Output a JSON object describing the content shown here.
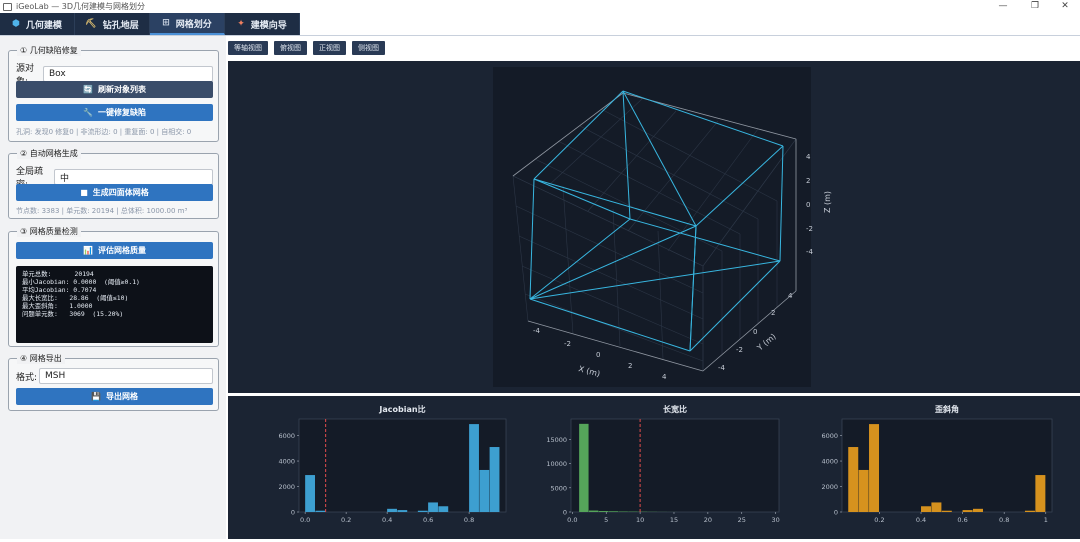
{
  "window": {
    "title": "iGeoLab — 3D几何建模与网格划分",
    "minimize_glyph": "—",
    "maximize_glyph": "❐",
    "close_glyph": "✕"
  },
  "tabs": [
    {
      "label": "几何建模",
      "icon": "cube-icon",
      "glyph": "⬢"
    },
    {
      "label": "钻孔地层",
      "icon": "drill-icon",
      "glyph": "⛏"
    },
    {
      "label": "网格划分",
      "icon": "mesh-icon",
      "glyph": "⊞"
    },
    {
      "label": "建模向导",
      "icon": "wand-icon",
      "glyph": "✦"
    }
  ],
  "repair": {
    "title": "① 几何缺陷修复",
    "source_label": "源对象:",
    "source_value": "Box",
    "refresh_label": "刷新对象列表",
    "refresh_glyph": "🔄",
    "fix_label": "一键修复缺陷",
    "fix_glyph": "🔧",
    "stats": "孔洞: 发现0 修复0 | 非流形边: 0 | 重复面: 0 | 自相交: 0"
  },
  "mesh_gen": {
    "title": "② 自动网格生成",
    "density_label": "全局疏密:",
    "density_value": "中",
    "generate_label": "生成四面体网格",
    "generate_glyph": "■",
    "stats": "节点数: 3383 | 单元数: 20194 | 总体积: 1000.00 m³"
  },
  "quality": {
    "title": "③ 网格质量检测",
    "evaluate_label": "评估网格质量",
    "evaluate_glyph": "📊",
    "report": [
      "单元总数:      20194",
      "最小Jacobian: 0.0000  (阈值≥0.1)",
      "平均Jacobian: 0.7074",
      "最大长宽比:   28.86  (阈值≤10)",
      "最大歪斜角:   1.0000",
      "问题单元数:   3069  (15.20%)"
    ]
  },
  "export": {
    "title": "④ 网格导出",
    "format_label": "格式:",
    "format_value": "MSH",
    "export_label": "导出网格",
    "export_glyph": "💾"
  },
  "view_buttons": [
    "等轴视图",
    "俯视图",
    "正视图",
    "侧视图"
  ],
  "view3d": {
    "xlabel": "X (m)",
    "ylabel": "Y (m)",
    "zlabel": "Z (m)",
    "x_ticks": [
      "-4",
      "-2",
      "0",
      "2",
      "4"
    ],
    "y_ticks": [
      "-4",
      "-2",
      "0",
      "2",
      "4"
    ],
    "z_ticks": [
      "-4",
      "-2",
      "0",
      "2",
      "4"
    ],
    "edge_color": "#38b6e0"
  },
  "chart_data": [
    {
      "type": "bar",
      "title": "Jacobian比",
      "xlabel": "",
      "ylabel": "",
      "bins": [
        0.0,
        0.05,
        0.1,
        0.15,
        0.2,
        0.25,
        0.3,
        0.35,
        0.4,
        0.45,
        0.5,
        0.55,
        0.6,
        0.65,
        0.7,
        0.75,
        0.8,
        0.85,
        0.9,
        0.95
      ],
      "values": [
        2900,
        100,
        0,
        0,
        0,
        0,
        0,
        0,
        250,
        150,
        0,
        100,
        750,
        450,
        0,
        0,
        6900,
        3300,
        5100
      ],
      "xlim": [
        -0.03,
        0.98
      ],
      "ylim": [
        0,
        7300
      ],
      "x_ticks": [
        0.0,
        0.2,
        0.4,
        0.6,
        0.8
      ],
      "y_ticks": [
        0,
        2000,
        4000,
        6000
      ],
      "threshold": 0.1,
      "color": "#3d9fd0",
      "threshold_color": "#e04b4b"
    },
    {
      "type": "bar",
      "title": "长宽比",
      "xlabel": "",
      "ylabel": "",
      "bins": [
        1.0,
        2.45,
        3.9,
        5.35,
        6.8,
        8.25,
        9.7,
        11.15,
        12.6,
        14.05,
        15.5
      ],
      "values": [
        18200,
        300,
        200,
        150,
        100,
        80,
        60,
        40,
        20,
        10
      ],
      "xlim": [
        -0.2,
        30.5
      ],
      "ylim": [
        0,
        19200
      ],
      "x_ticks": [
        0,
        5,
        10,
        15,
        20,
        25,
        30
      ],
      "y_ticks": [
        0,
        5000,
        10000,
        15000
      ],
      "threshold": 10,
      "color": "#55a55a",
      "threshold_color": "#e04b4b"
    },
    {
      "type": "bar",
      "title": "歪斜角",
      "xlabel": "",
      "ylabel": "",
      "bins": [
        0.05,
        0.1,
        0.15,
        0.2,
        0.25,
        0.3,
        0.35,
        0.4,
        0.45,
        0.5,
        0.55,
        0.6,
        0.65,
        0.7,
        0.75,
        0.8,
        0.85,
        0.9,
        0.95,
        1.0
      ],
      "values": [
        5100,
        3300,
        6900,
        0,
        0,
        0,
        0,
        450,
        750,
        100,
        0,
        150,
        250,
        0,
        0,
        0,
        0,
        100,
        2900
      ],
      "xlim": [
        0.02,
        1.03
      ],
      "ylim": [
        0,
        7300
      ],
      "x_ticks": [
        0.2,
        0.4,
        0.6,
        0.8,
        1.0
      ],
      "y_ticks": [
        0,
        2000,
        4000,
        6000
      ],
      "color": "#d6921e"
    }
  ]
}
